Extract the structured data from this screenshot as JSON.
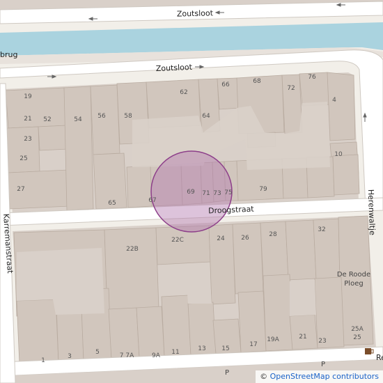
{
  "map": {
    "colors": {
      "background": "#f2efe9",
      "water": "#aad3df",
      "road": "#ffffff",
      "road_casing": "#cfc9c2",
      "block": "#d9d0c9",
      "building": "#d1c6bd",
      "building_edge": "#b9aca1",
      "marker_fill": "#b47ab0",
      "marker_stroke": "#8d3f8a"
    },
    "streets": {
      "zoutsloot_top": "Zoutsloot",
      "zoutsloot_mid": "Zoutsloot",
      "droogstraat": "Droogstraat",
      "herenwaltje": "Herenwaltje",
      "karremanstraat": "Karremanstraat",
      "brug_fragment": "brug",
      "re_fragment": "Re"
    },
    "poi": {
      "de_roode": "De Roode",
      "ploeg": "Ploeg",
      "parking": "P"
    },
    "house_numbers": {
      "n19": "19",
      "n21": "21",
      "n23": "23",
      "n25": "25",
      "n27": "27",
      "n52": "52",
      "n54": "54",
      "n56": "56",
      "n58": "58",
      "n62": "62",
      "n64": "64",
      "n66": "66",
      "n68": "68",
      "n72": "72",
      "n76": "76",
      "n4": "4",
      "n10": "10",
      "n65": "65",
      "n67": "67",
      "n69": "69",
      "n71": "71",
      "n73": "73",
      "n75": "75",
      "n79": "79",
      "n22b": "22B",
      "n22c": "22C",
      "n24": "24",
      "n26": "26",
      "n28": "28",
      "n32": "32",
      "n1": "1",
      "n3": "3",
      "n5": "5",
      "n7a": "7 7A",
      "n9a": "9A",
      "n11": "11",
      "n13": "13",
      "n15": "15",
      "n17": "17",
      "n19a": "19A",
      "n21b": "21",
      "n23b": "23",
      "n25a": "25A"
    }
  },
  "attribution": {
    "copyright": "©",
    "text": "OpenStreetMap contributors"
  }
}
